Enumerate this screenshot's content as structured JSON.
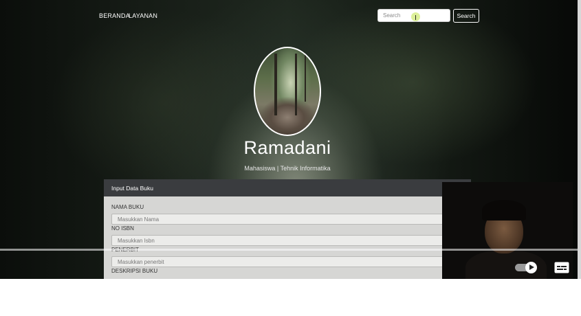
{
  "nav": {
    "links": [
      "BERANDA",
      "LAYANAN"
    ],
    "search_placeholder": "Search",
    "search_button": "Search"
  },
  "profile": {
    "name": "Ramadani",
    "role": "Mahasiswa | Tehnik Informatika"
  },
  "form": {
    "title": "Input Data Buku",
    "fields": [
      {
        "label": "NAMA BUKU",
        "placeholder": "Masukkan Nama"
      },
      {
        "label": "NO ISBN",
        "placeholder": "Masukkan Isbn"
      },
      {
        "label": "PENERBIT",
        "placeholder": "Masukkan penerbit"
      },
      {
        "label": "DESKRIPSI BUKU"
      }
    ]
  },
  "player": {
    "progress": 0.0,
    "icons": [
      "play-toggle-icon",
      "captions-icon"
    ]
  },
  "colors": {
    "card_header": "#3a3c3f",
    "card_body": "#d6d6d4",
    "nav_text": "#ffffff"
  }
}
